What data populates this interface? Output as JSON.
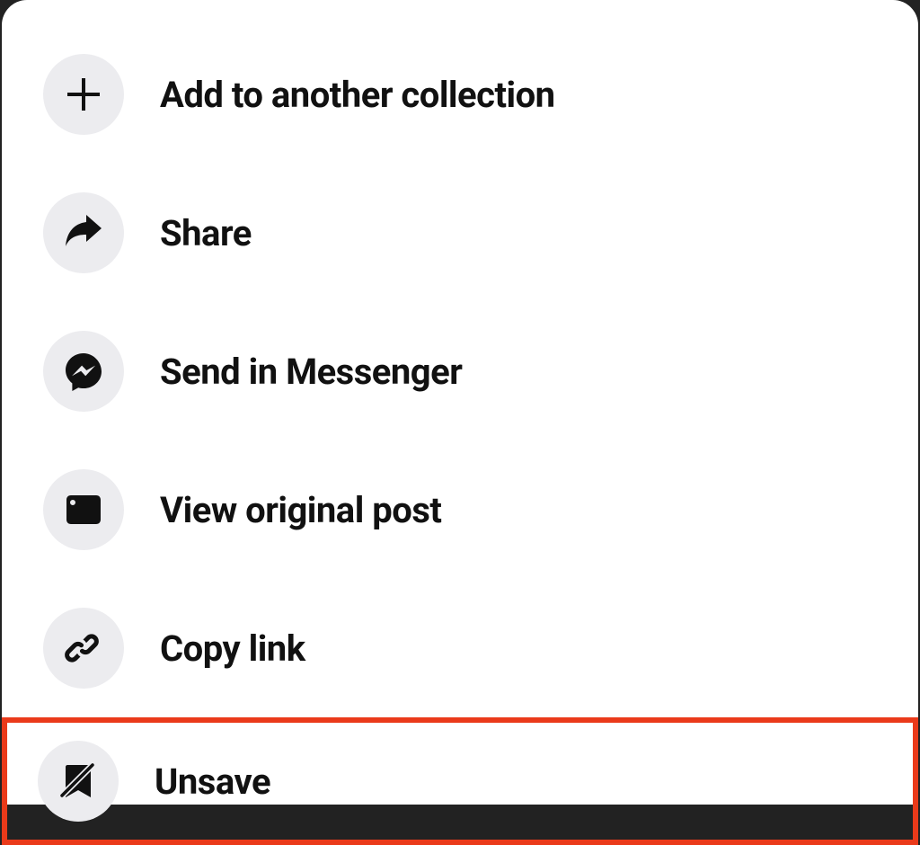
{
  "menu": {
    "items": [
      {
        "label": "Add to another collection",
        "icon": "plus-icon",
        "highlighted": false
      },
      {
        "label": "Share",
        "icon": "share-icon",
        "highlighted": false
      },
      {
        "label": "Send in Messenger",
        "icon": "messenger-icon",
        "highlighted": false
      },
      {
        "label": "View original post",
        "icon": "post-icon",
        "highlighted": false
      },
      {
        "label": "Copy link",
        "icon": "link-icon",
        "highlighted": false
      },
      {
        "label": "Unsave",
        "icon": "unsave-icon",
        "highlighted": true
      }
    ]
  }
}
